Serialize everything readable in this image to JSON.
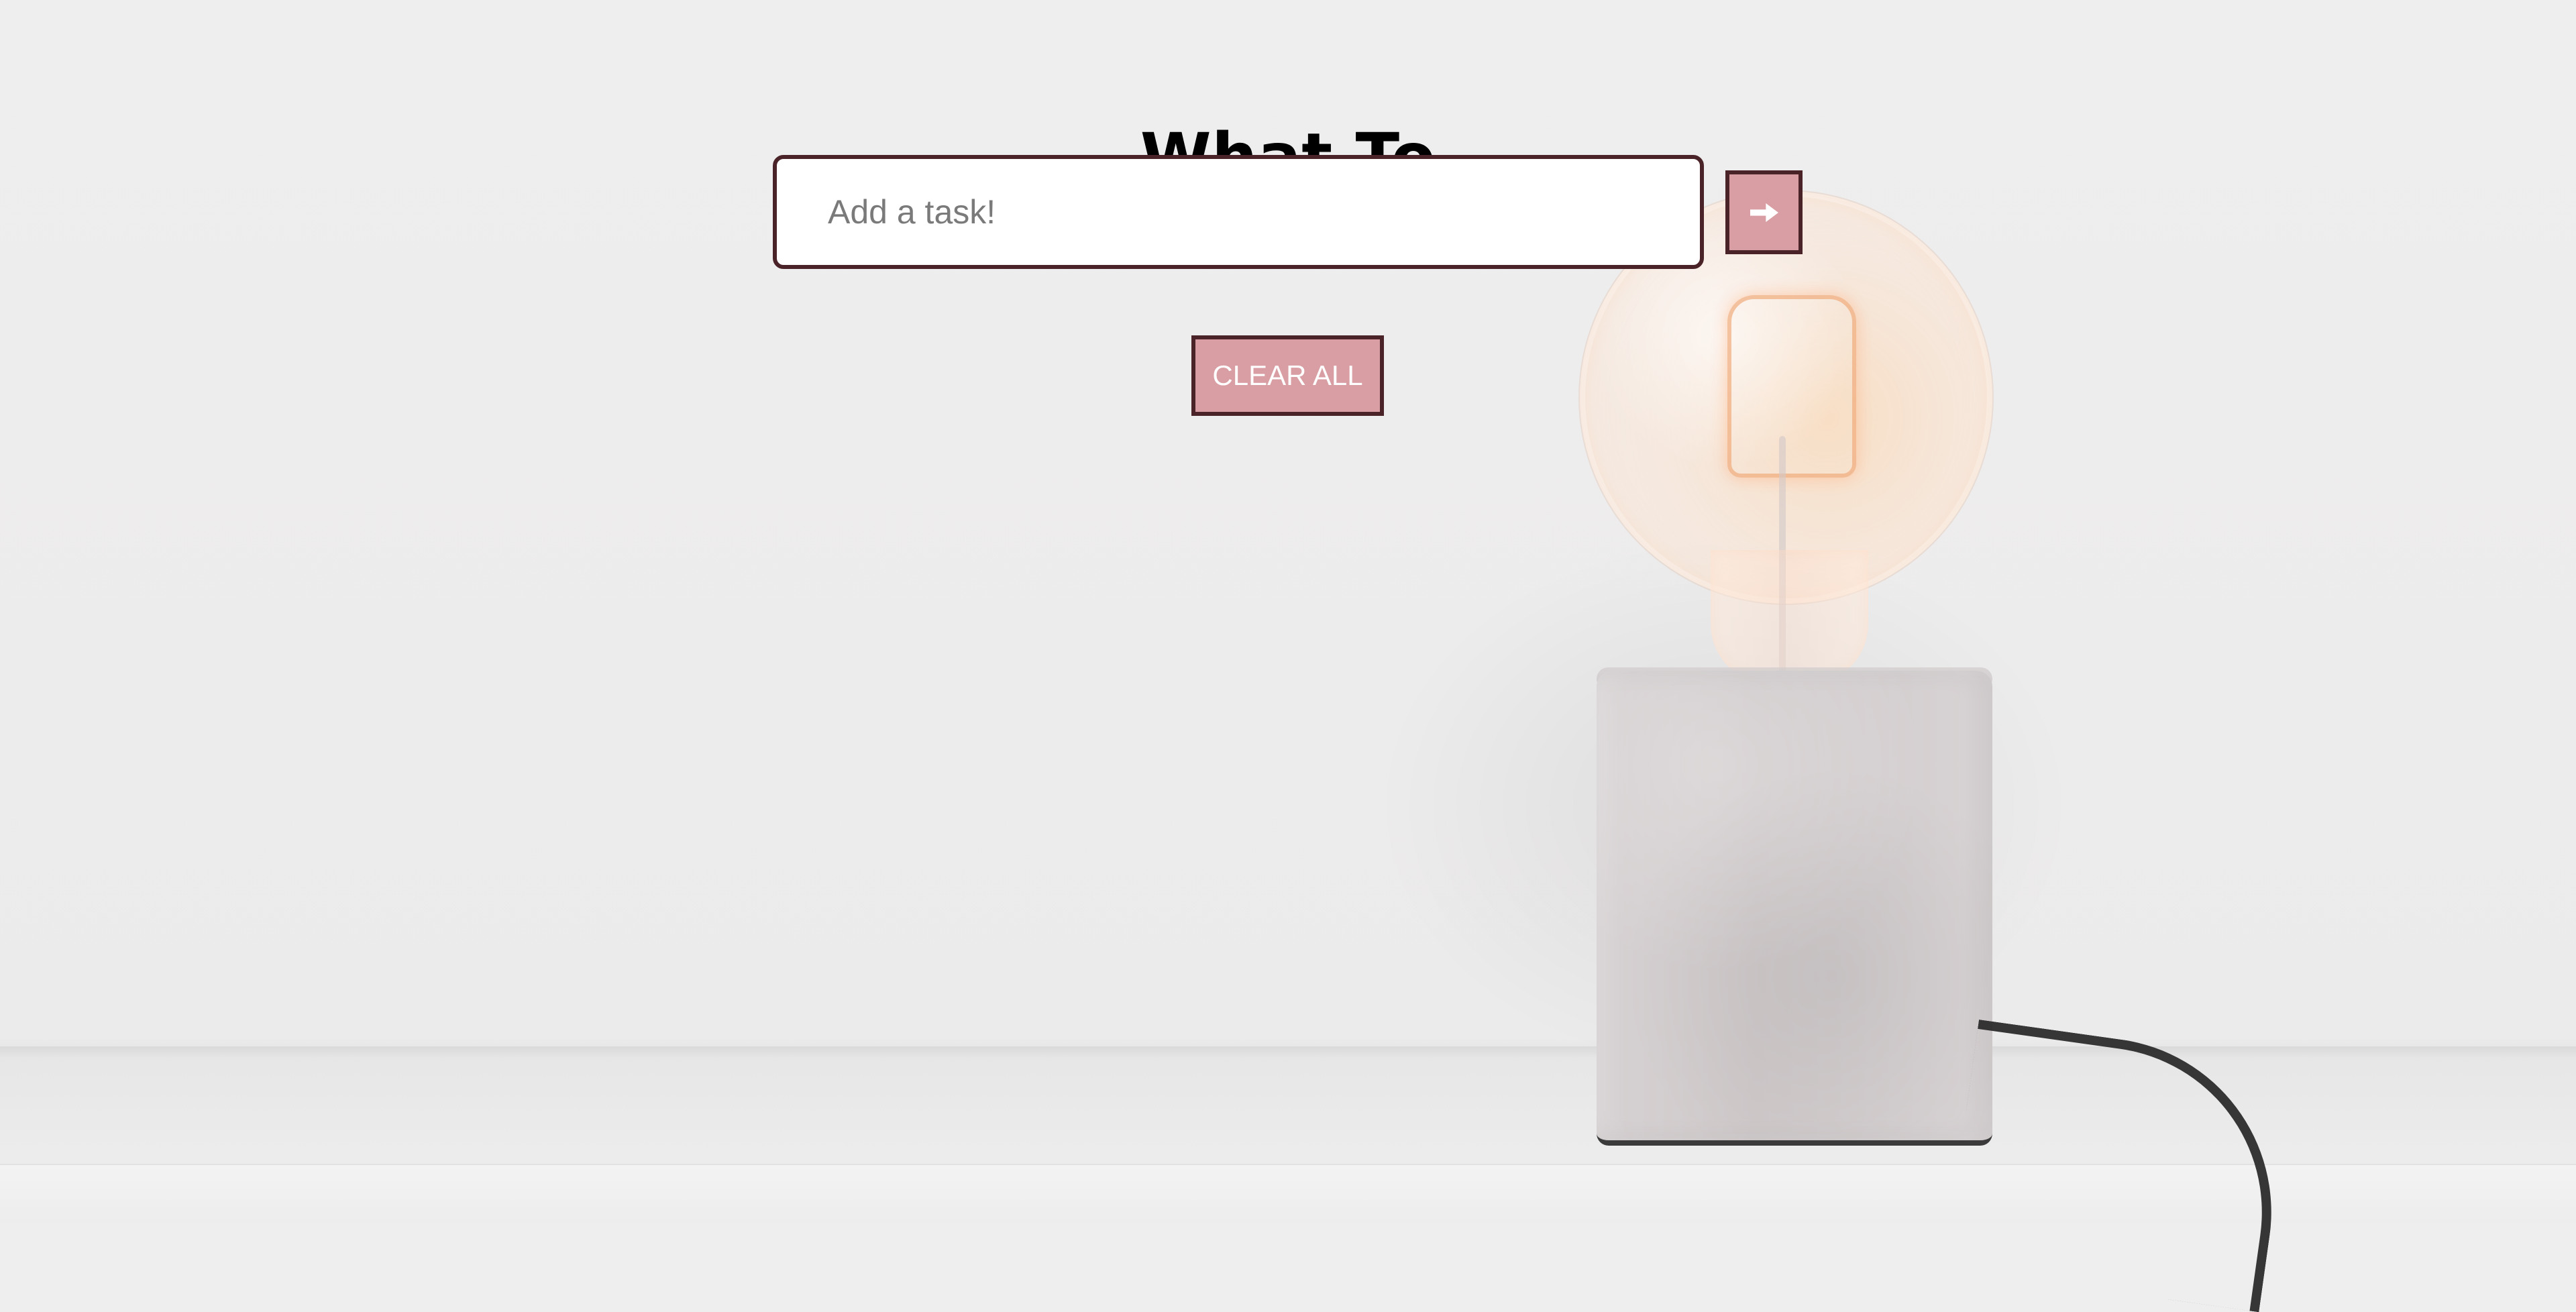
{
  "app": {
    "title": "What To Do?",
    "task_input": {
      "placeholder": "Add a task!",
      "value": ""
    },
    "add_button": {
      "icon": "arrow-right-icon"
    },
    "clear_button": {
      "label": "CLEAR ALL"
    }
  },
  "colors": {
    "border": "#4a2328",
    "button_fill": "#d99ea3",
    "title_text": "#000000",
    "button_text": "#ffffff"
  }
}
